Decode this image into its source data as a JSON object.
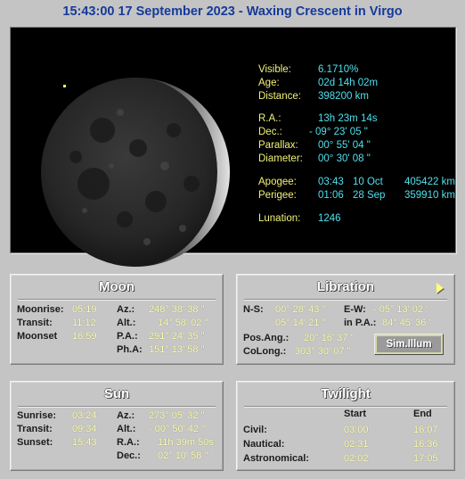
{
  "title": "15:43:00  17 September 2023 - Waxing Crescent in Virgo",
  "moon_info": {
    "visible_label": "Visible:",
    "visible": "6.1710%",
    "age_label": "Age:",
    "age": "02d 14h 02m",
    "distance_label": "Distance:",
    "distance": "398200 km",
    "ra_label": "R.A.:",
    "ra": "13h 23m 14s",
    "dec_label": "Dec.:",
    "dec": "- 09° 23' 05 \"",
    "parallax_label": "Parallax:",
    "parallax": "00° 55' 04 \"",
    "diameter_label": "Diameter:",
    "diameter": "00° 30' 08 \"",
    "apogee_label": "Apogee:",
    "apogee_time": "03:43",
    "apogee_date": "10 Oct",
    "apogee_km": "405422 km",
    "perigee_label": "Perigee:",
    "perigee_time": "01:06",
    "perigee_date": "28 Sep",
    "perigee_km": "359910 km",
    "lunation_label": "Lunation:",
    "lunation": "1246"
  },
  "moon_box": {
    "title": "Moon",
    "moonrise_label": "Moonrise:",
    "moonrise": "05:19",
    "transit_label": "Transit:",
    "transit": "11:12",
    "moonset_label": "Moonset",
    "moonset": "16:59",
    "az_label": "Az.:",
    "az": "248° 38' 38 \"",
    "alt_label": "Alt.:",
    "alt": "14° 58' 02 \"",
    "pa_label": "P.A.:",
    "pa": "291° 24' 35 \"",
    "pha_label": "Ph.A:",
    "pha": "151° 13' 58 \""
  },
  "libration_box": {
    "title": "Libration",
    "ns_label": "N-S:",
    "ns": "00° 28' 43 \"",
    "ew_label": "E-W:",
    "ew": "- 05° 13' 02 '",
    "ns2": "05° 14' 21 \"",
    "inpa_label": "in P.A.:",
    "inpa": "84° 45' 36 '",
    "posang_label": "Pos.Ang.:",
    "posang": "20° 16' 37 \"",
    "colong_label": "CoLong.:",
    "colong": "303° 30' 07 \"",
    "button": "Sim.Illum"
  },
  "sun_box": {
    "title": "Sun",
    "sunrise_label": "Sunrise:",
    "sunrise": "03:24",
    "transit_label": "Transit:",
    "transit": "09:34",
    "sunset_label": "Sunset:",
    "sunset": "15:43",
    "az_label": "Az.:",
    "az": "273° 05' 32 \"",
    "alt_label": "Alt.:",
    "alt": "- 00° 50' 42 \"",
    "ra_label": "R.A.:",
    "ra": "11h 39m 50s",
    "dec_label": "Dec.:",
    "dec": "02° 10' 58 \""
  },
  "twilight_box": {
    "title": "Twilight",
    "start_header": "Start",
    "end_header": "End",
    "rows": [
      {
        "label": "Civil:",
        "start": "03:00",
        "end": "16:07"
      },
      {
        "label": "Nautical:",
        "start": "02:31",
        "end": "16:36"
      },
      {
        "label": "Astronomical:",
        "start": "02:02",
        "end": "17:05"
      }
    ]
  },
  "colors": {
    "title": "#163a9a",
    "label_yellow": "#f2f27a",
    "value_cyan": "#4fe0ef",
    "panel_bg": "#c6c6c6",
    "value_pale_yellow": "#ffffb0"
  }
}
